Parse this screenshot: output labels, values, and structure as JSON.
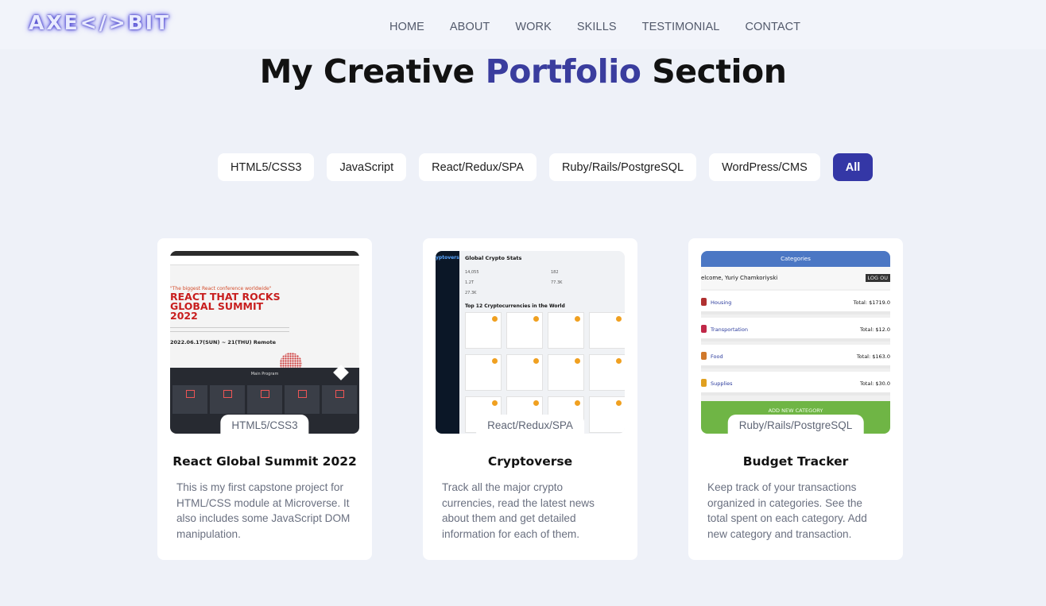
{
  "header": {
    "logo": "AXE</>BIT",
    "nav": [
      "HOME",
      "ABOUT",
      "WORK",
      "SKILLS",
      "TESTIMONIAL",
      "CONTACT"
    ]
  },
  "portfolio": {
    "title_before": "My Creative ",
    "title_accent": "Portfolio",
    "title_after": " Section",
    "filters": [
      "HTML5/CSS3",
      "JavaScript",
      "React/Redux/SPA",
      "Ruby/Rails/PostgreSQL",
      "WordPress/CMS",
      "All"
    ],
    "active_filter": "All",
    "cards": [
      {
        "tag": "HTML5/CSS3",
        "title": "React Global Summit 2022",
        "description": "This is my first capstone project for HTML/CSS module at Microverse. It also includes some JavaScript DOM manipulation.",
        "thumb": {
          "quote": "\"The biggest React conference worldwide\"",
          "headline_1": "REACT THAT ROCKS",
          "headline_2": "GLOBAL SUMMIT",
          "headline_3": "2022",
          "date": "2022.06.17(SUN) ~ 21(THU) Remote",
          "program": "Main Program"
        }
      },
      {
        "tag": "React/Redux/SPA",
        "title": "Cryptoverse",
        "description": "Track all the major crypto currencies, read the latest news about them and get detailed information for each of them.",
        "thumb": {
          "brand": "yptoverse",
          "heading": "Global Crypto Stats",
          "subheading": "Top 12 Cryptocurrencies in the World",
          "stats": [
            "14,055",
            "182",
            "1.2T",
            "77.3K",
            "27.3K"
          ]
        }
      },
      {
        "tag": "Ruby/Rails/PostgreSQL",
        "title": "Budget Tracker",
        "description": "Keep track of your transactions organized in categories. See the total spent on each category. Add new category and transaction.",
        "thumb": {
          "header": "Categories",
          "welcome": "elcome, Yuriy Chamkoriyski",
          "logout": "LOG OU",
          "rows": [
            {
              "label": "Housing",
              "total": "Total: $1719.0",
              "color": "#b03030"
            },
            {
              "label": "Transportation",
              "total": "Total: $12.0",
              "color": "#c02848"
            },
            {
              "label": "Food",
              "total": "Total: $163.0",
              "color": "#d0782a"
            },
            {
              "label": "Supplies",
              "total": "Total: $30.0",
              "color": "#e0a020"
            }
          ],
          "add": "ADD NEW CATEGORY"
        }
      }
    ]
  }
}
